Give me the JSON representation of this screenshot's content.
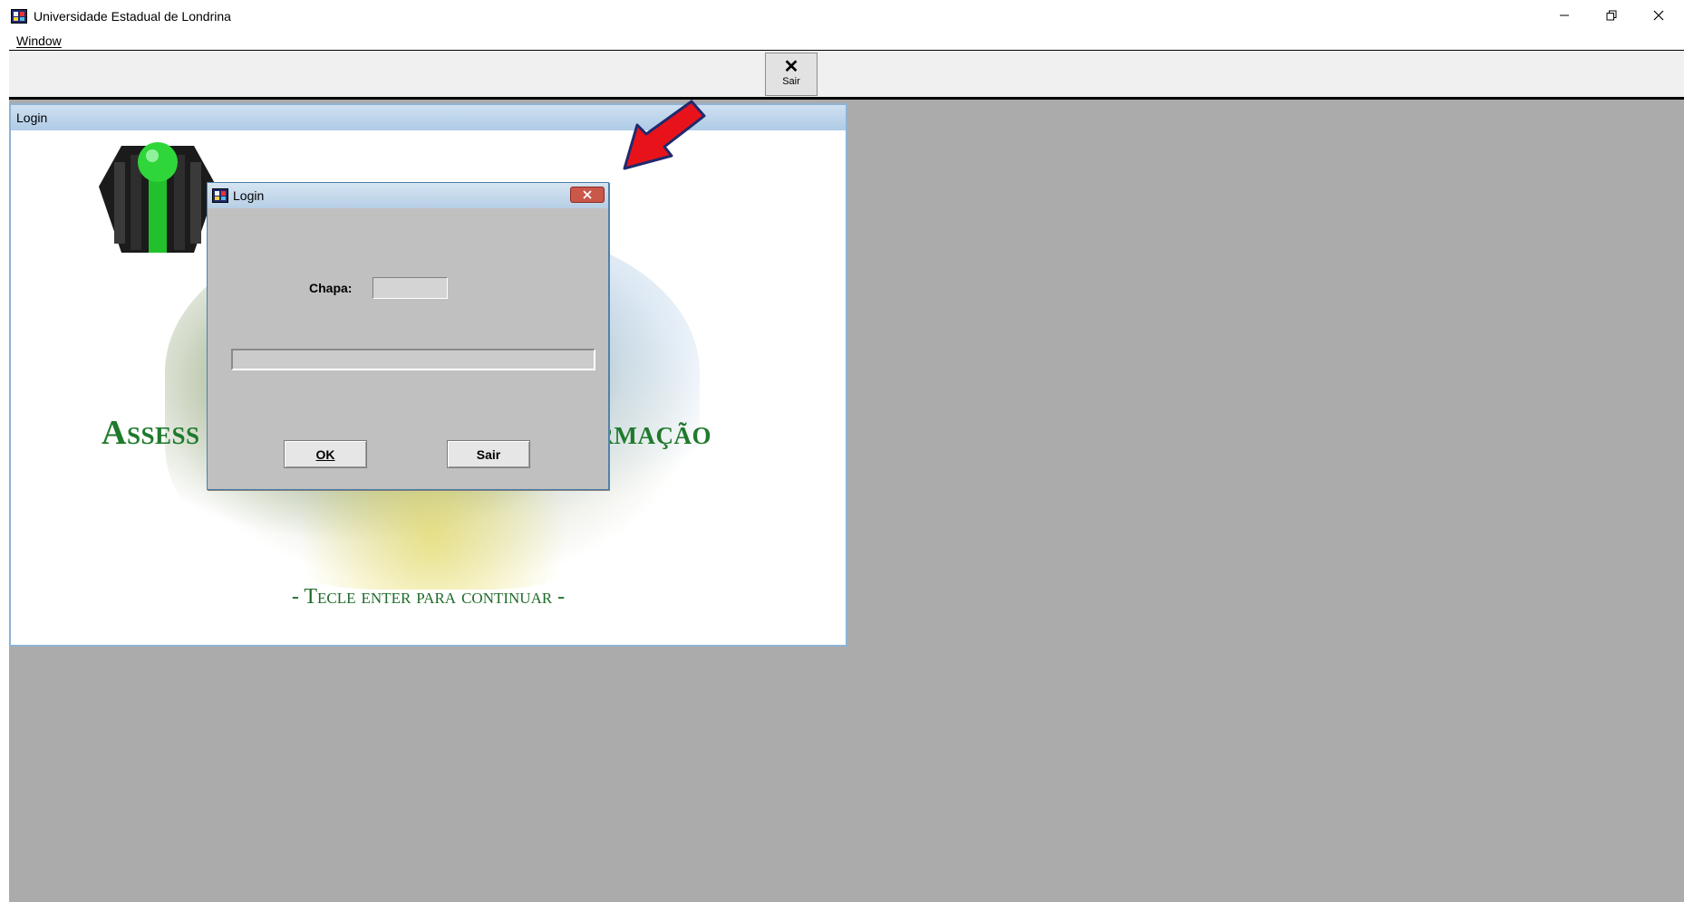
{
  "window": {
    "title": "Universidade Estadual de Londrina",
    "controls": {
      "minimize": "minimize-icon",
      "restore": "restore-icon",
      "close": "close-icon"
    }
  },
  "menu": {
    "items": [
      {
        "label": "Window"
      }
    ]
  },
  "toolbar": {
    "exit_label": "Sair",
    "exit_icon": "close-x-icon"
  },
  "splash": {
    "title": "Login",
    "heading_left": "Assess",
    "heading_right": "rmação",
    "footer": "- Tecle enter para continuar -"
  },
  "dialog": {
    "title": "Login",
    "chapa_label": "Chapa:",
    "chapa_value": "",
    "message_value": "",
    "ok_label": "OK",
    "sair_label": "Sair"
  },
  "colors": {
    "accent_green": "#1f7a2c",
    "arrow_red": "#e8131a",
    "mdi_background": "#ababab",
    "dialog_background": "#c0c0c0"
  }
}
